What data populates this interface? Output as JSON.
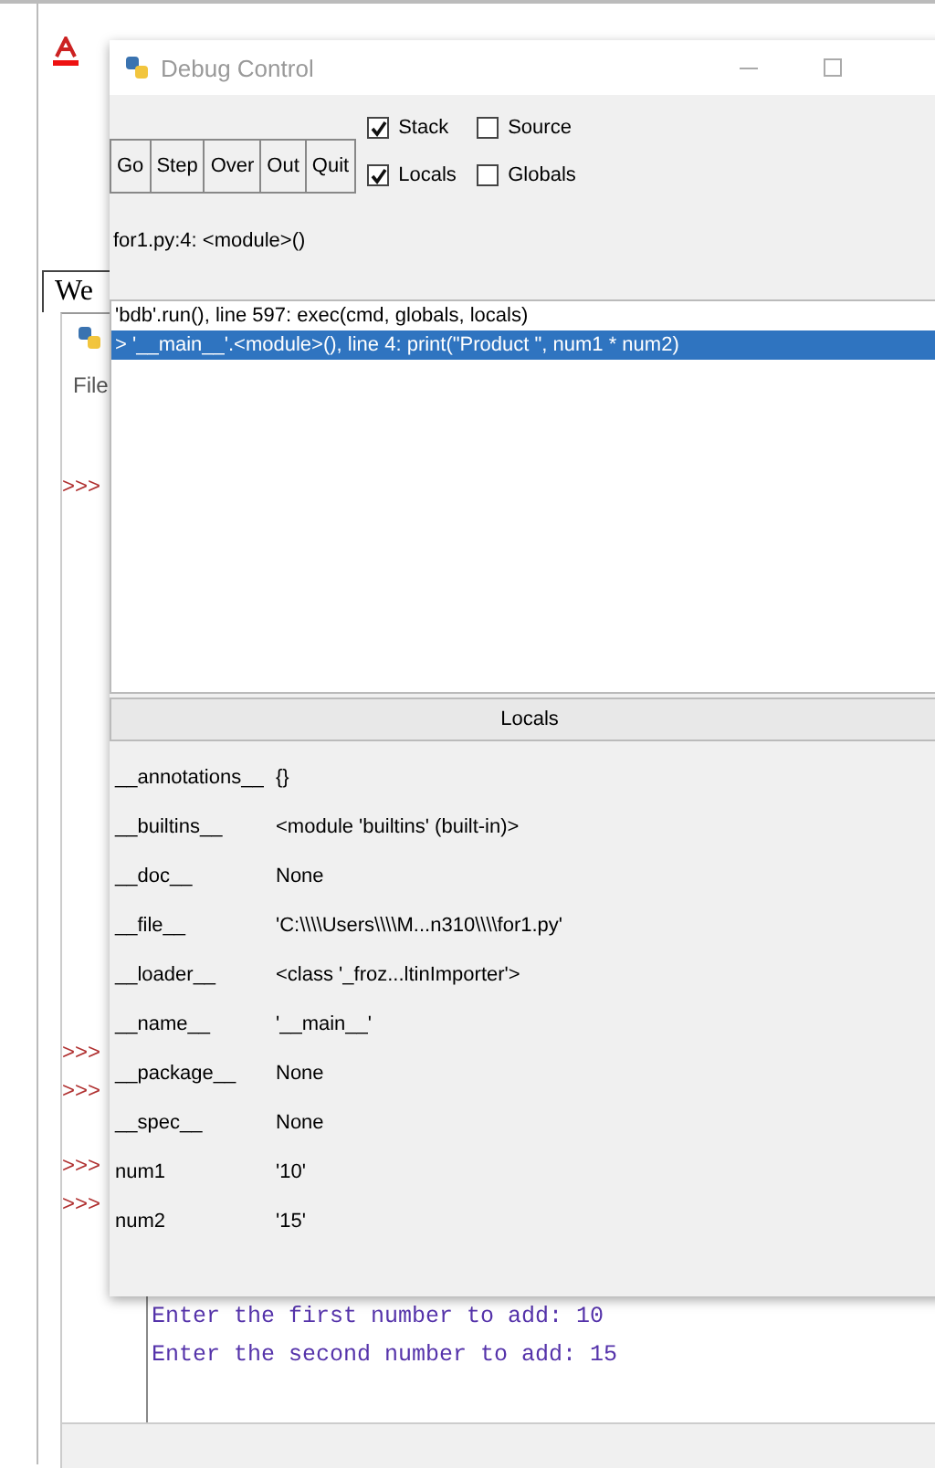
{
  "background": {
    "tab_label": "We",
    "menu": [
      "File"
    ],
    "prompts": [
      ">>>",
      ">>>",
      ">>>",
      ">>>",
      ">>>"
    ],
    "output_lines": [
      "Enter the first number to add: 10",
      "Enter the second number to add: 15"
    ]
  },
  "debug_window": {
    "title": "Debug Control",
    "buttons": [
      "Go",
      "Step",
      "Over",
      "Out",
      "Quit"
    ],
    "options": [
      {
        "label": "Stack",
        "checked": true
      },
      {
        "label": "Source",
        "checked": false
      },
      {
        "label": "Locals",
        "checked": true
      },
      {
        "label": "Globals",
        "checked": false
      }
    ],
    "status": "for1.py:4: <module>()",
    "stack": [
      {
        "text": "'bdb'.run(), line 597: exec(cmd, globals, locals)",
        "selected": false
      },
      {
        "text": "> '__main__'.<module>(), line 4: print(\"Product \", num1 * num2)",
        "selected": true
      }
    ],
    "locals_title": "Locals",
    "locals": [
      {
        "name": "__annotations__",
        "value": "{}"
      },
      {
        "name": "__builtins__",
        "value": "<module 'builtins' (built-in)>"
      },
      {
        "name": "__doc__",
        "value": "None"
      },
      {
        "name": "__file__",
        "value": "'C:\\\\\\\\Users\\\\\\\\M...n310\\\\\\\\for1.py'"
      },
      {
        "name": "__loader__",
        "value": "<class '_froz...ltinImporter'>"
      },
      {
        "name": "__name__",
        "value": "'__main__'"
      },
      {
        "name": "__package__",
        "value": "None"
      },
      {
        "name": "__spec__",
        "value": "None"
      },
      {
        "name": "num1",
        "value": "'10'"
      },
      {
        "name": "num2",
        "value": "'15'"
      }
    ]
  }
}
